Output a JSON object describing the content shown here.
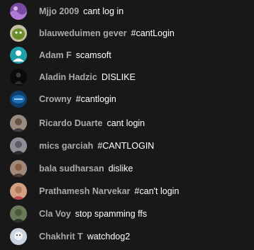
{
  "messages": [
    {
      "author": "Mjjo 2009",
      "text": "cant log in",
      "avatar": "purple-wave-avatar",
      "avatar_color": "#7a4aa0"
    },
    {
      "author": "blauweduimen gever",
      "text": "#cantLogin",
      "avatar": "green-character-avatar",
      "avatar_color": "#6a8d2a"
    },
    {
      "author": "Adam F",
      "text": "scamsoft",
      "avatar": "default-person-avatar",
      "avatar_color": "#1fa0a8"
    },
    {
      "author": "Aladin Hadzic",
      "text": "DISLIKE",
      "avatar": "dark-figure-avatar",
      "avatar_color": "#1a1a1a"
    },
    {
      "author": "Crowny",
      "text": "#cantlogin",
      "avatar": "blue-logo-avatar",
      "avatar_color": "#1e6fb8"
    },
    {
      "author": "Ricardo Duarte",
      "text": "cant login",
      "avatar": "photo-avatar",
      "avatar_color": "#7a6a60"
    },
    {
      "author": "mics garciah",
      "text": "#CANTLOGIN",
      "avatar": "photo-avatar",
      "avatar_color": "#5e5e66"
    },
    {
      "author": "bala sudharsan",
      "text": "dislike",
      "avatar": "photo-avatar",
      "avatar_color": "#8a5c40"
    },
    {
      "author": "Prathamesh Narvekar",
      "text": "#can't login",
      "avatar": "photo-avatar",
      "avatar_color": "#b07a5a"
    },
    {
      "author": "Cla Voy",
      "text": "stop spamming ffs",
      "avatar": "photo-avatar",
      "avatar_color": "#4a5a40"
    },
    {
      "author": "Chakhrit T",
      "text": "watchdog2",
      "avatar": "character-avatar",
      "avatar_color": "#c8d4e0"
    }
  ]
}
